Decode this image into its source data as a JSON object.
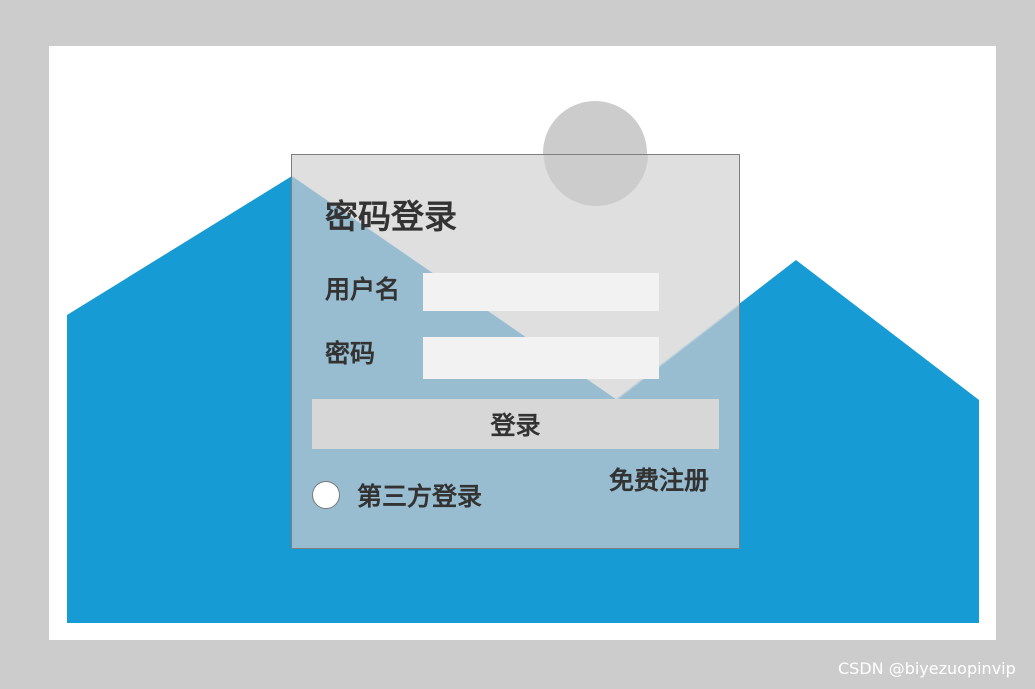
{
  "login_form": {
    "title": "密码登录",
    "username_label": "用户名",
    "username_value": "",
    "password_label": "密码",
    "password_value": "",
    "login_button": "登录",
    "third_party_label": "第三方登录",
    "register_link": "免费注册"
  },
  "footer": {
    "watermark": "CSDN @biyezuopinvip"
  },
  "colors": {
    "outer_background": "#cccccc",
    "canvas_background": "#ffffff",
    "mountain": "#169bd5",
    "card_overlay": "#d7d7d7",
    "card_overlay_over_mountain": "#98bdd0",
    "sun": "#cccccc",
    "input_background": "#f2f2f2",
    "button_background": "#d7d7d7",
    "text": "#333333"
  }
}
